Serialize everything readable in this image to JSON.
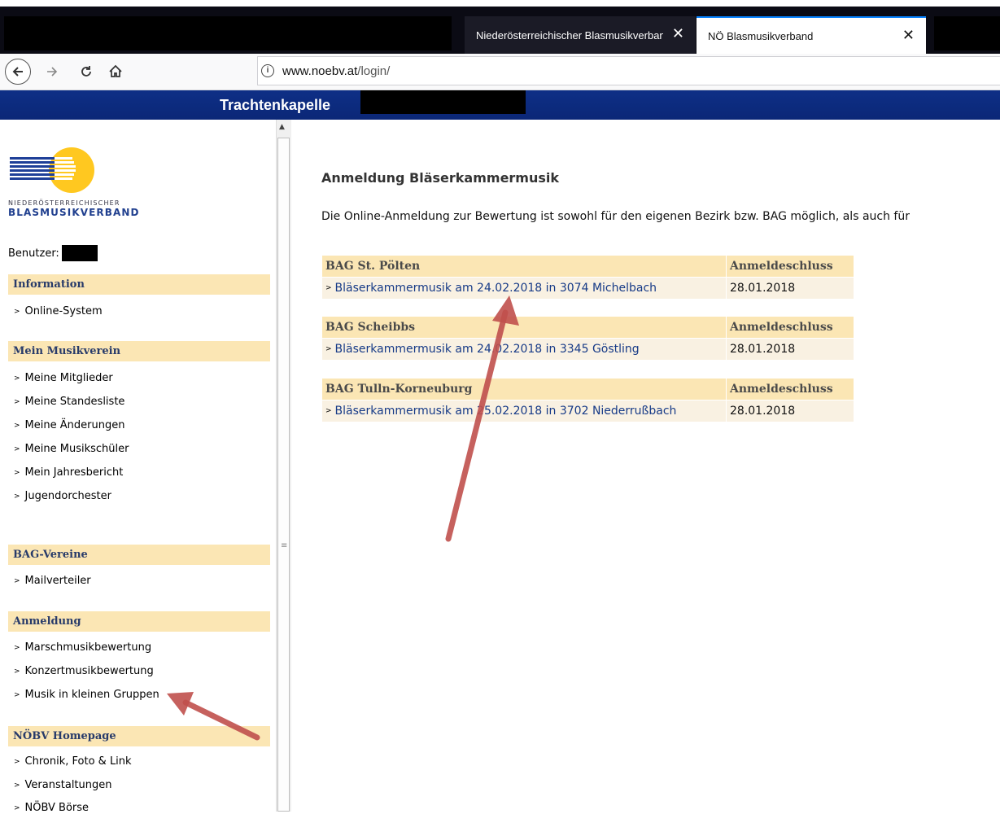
{
  "browser": {
    "tabs": [
      {
        "title": "Niederösterreichischer Blasmusikverband",
        "close": "✕"
      },
      {
        "title": "NÖ Blasmusikverband",
        "close": "✕"
      }
    ],
    "url_host": "www.noebv.at",
    "url_path": "/login/"
  },
  "header": {
    "title": "Trachtenkapelle"
  },
  "logo": {
    "line1": "NIEDERÖSTERREICHISCHER",
    "line2": "BLASMUSIKVERBAND"
  },
  "sidebar": {
    "user_label": "Benutzer:",
    "sections": [
      {
        "title": "Information",
        "items": [
          "Online-System"
        ]
      },
      {
        "title": "Mein Musikverein",
        "items": [
          "Meine Mitglieder",
          "Meine Standesliste",
          "Meine Änderungen",
          "Meine Musikschüler",
          "Mein Jahresbericht",
          "Jugendorchester"
        ]
      },
      {
        "title": "BAG-Vereine",
        "items": [
          "Mailverteiler"
        ]
      },
      {
        "title": "Anmeldung",
        "items": [
          "Marschmusikbewertung",
          "Konzertmusikbewertung",
          "Musik in kleinen Gruppen"
        ]
      },
      {
        "title": "NÖBV Homepage",
        "items": [
          "Chronik, Foto & Link",
          "Veranstaltungen",
          "NÖBV Börse"
        ]
      }
    ]
  },
  "main": {
    "title": "Anmeldung Bläserkammermusik",
    "intro": "Die Online-Anmeldung zur Bewertung ist sowohl für den eigenen Bezirk bzw. BAG möglich, als auch für",
    "deadline_header": "Anmeldeschluss",
    "groups": [
      {
        "name": "BAG St. Pölten",
        "event": "Bläserkammermusik am 24.02.2018 in 3074 Michelbach",
        "deadline": "28.01.2018"
      },
      {
        "name": "BAG Scheibbs",
        "event": "Bläserkammermusik am 24.02.2018 in 3345 Göstling",
        "deadline": "28.01.2018"
      },
      {
        "name": "BAG Tulln-Korneuburg",
        "event": "Bläserkammermusik am 25.02.2018 in 3702 Niederrußbach",
        "deadline": "28.01.2018"
      }
    ]
  },
  "colors": {
    "header_blue": "#0e2f86",
    "section_bg": "#fbe6b4",
    "link_blue": "#163a87",
    "annotation_arrow": "#c0504d"
  }
}
